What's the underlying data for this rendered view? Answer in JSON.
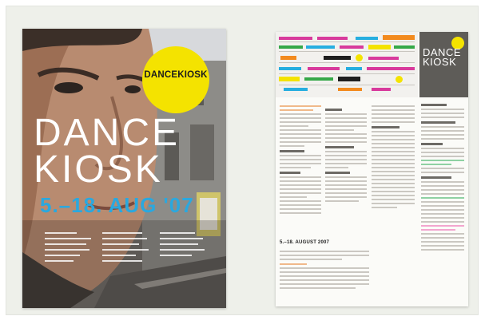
{
  "poster": {
    "badge_title": "DANCEKIOSK",
    "title_line1": "DANCE",
    "title_line2": "KIOSK",
    "date": "5.–18. AUG '07"
  },
  "newspaper": {
    "cover_line1": "DANCE",
    "cover_line2": "KIOSK",
    "headline": "5.–18. AUGUST 2007"
  },
  "colors": {
    "background": "#eef0ea",
    "yellow": "#f4e300",
    "blue": "#2aa8df",
    "magenta": "#d83a9c",
    "orange": "#f28a1e",
    "green": "#35a848",
    "cyan": "#27aee0"
  }
}
